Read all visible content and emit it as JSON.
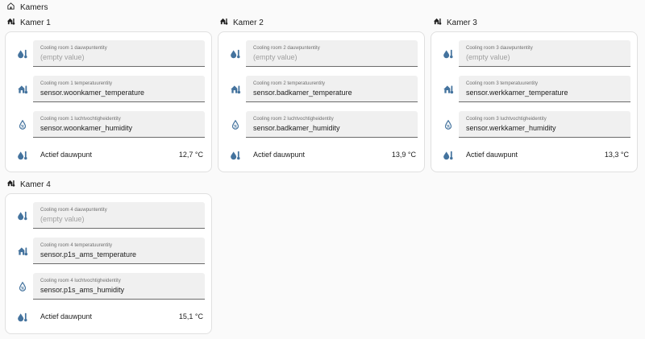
{
  "section": {
    "title": "Kamers",
    "icon": "home-outline-icon"
  },
  "colors": {
    "icon": "#44739e",
    "field_bg": "#f0f0f0",
    "card_border": "#e0e0e0"
  },
  "rooms": [
    {
      "title": "Kamer 1",
      "fields": [
        {
          "label": "Cooling room 1 dauwpuntentity",
          "value": "(empty value)",
          "icon": "dew-point-icon"
        },
        {
          "label": "Cooling room 1 temperatuurentity",
          "value": "sensor.woonkamer_temperature",
          "icon": "home-thermometer-icon"
        },
        {
          "label": "Cooling room 1 luchtvochtigheidentity",
          "value": "sensor.woonkamer_humidity",
          "icon": "water-percent-icon"
        }
      ],
      "sensor": {
        "name": "Actief dauwpunt",
        "value": "12,7 °C",
        "icon": "dew-point-icon"
      }
    },
    {
      "title": "Kamer 2",
      "fields": [
        {
          "label": "Cooling room 2 dauwpuntentity",
          "value": "(empty value)",
          "icon": "dew-point-icon"
        },
        {
          "label": "Cooling room 2 temperatuurentity",
          "value": "sensor.badkamer_temperature",
          "icon": "home-thermometer-icon"
        },
        {
          "label": "Cooling room 2 luchtvochtigheidentity",
          "value": "sensor.badkamer_humidity",
          "icon": "water-percent-icon"
        }
      ],
      "sensor": {
        "name": "Actief dauwpunt",
        "value": "13,9 °C",
        "icon": "dew-point-icon"
      }
    },
    {
      "title": "Kamer 3",
      "fields": [
        {
          "label": "Cooling room 3 dauwpuntentity",
          "value": "(empty value)",
          "icon": "dew-point-icon"
        },
        {
          "label": "Cooling room 3 temperatuurentity",
          "value": "sensor.werkkamer_temperature",
          "icon": "home-thermometer-icon"
        },
        {
          "label": "Cooling room 3 luchtvochtigheidentity",
          "value": "sensor.werkkamer_humidity",
          "icon": "water-percent-icon"
        }
      ],
      "sensor": {
        "name": "Actief dauwpunt",
        "value": "13,3 °C",
        "icon": "dew-point-icon"
      }
    },
    {
      "title": "Kamer 4",
      "fields": [
        {
          "label": "Cooling room 4 dauwpuntentity",
          "value": "(empty value)",
          "icon": "dew-point-icon"
        },
        {
          "label": "Cooling room 4 temperatuurentity",
          "value": "sensor.p1s_ams_temperature",
          "icon": "home-thermometer-icon"
        },
        {
          "label": "Cooling room 4 luchtvochtigheidentity",
          "value": "sensor.p1s_ams_humidity",
          "icon": "water-percent-icon"
        }
      ],
      "sensor": {
        "name": "Actief dauwpunt",
        "value": "15,1 °C",
        "icon": "dew-point-icon"
      }
    }
  ]
}
